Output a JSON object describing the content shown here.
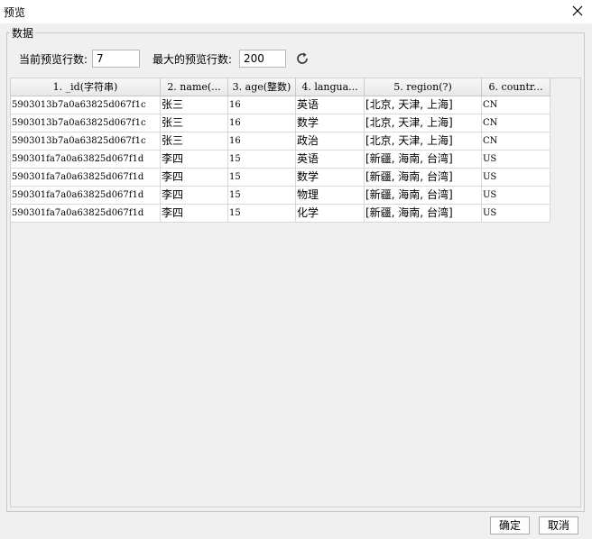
{
  "window": {
    "title": "预览"
  },
  "group": {
    "label": "数据"
  },
  "preview": {
    "current_rows_label": "当前预览行数:",
    "current_rows_value": "7",
    "max_rows_label": "最大的预览行数:",
    "max_rows_value": "200"
  },
  "table": {
    "columns": [
      "1. _id(字符串)",
      "2. name(...",
      "3. age(整数)",
      "4. langua...",
      "5. region(?)",
      "6. countr..."
    ],
    "rows": [
      [
        "5903013b7a0a63825d067f1c",
        "张三",
        "16",
        "英语",
        "[北京, 天津, 上海]",
        "CN"
      ],
      [
        "5903013b7a0a63825d067f1c",
        "张三",
        "16",
        "数学",
        "[北京, 天津, 上海]",
        "CN"
      ],
      [
        "5903013b7a0a63825d067f1c",
        "张三",
        "16",
        "政治",
        "[北京, 天津, 上海]",
        "CN"
      ],
      [
        "590301fa7a0a63825d067f1d",
        "李四",
        "15",
        "英语",
        "[新疆, 海南, 台湾]",
        "US"
      ],
      [
        "590301fa7a0a63825d067f1d",
        "李四",
        "15",
        "数学",
        "[新疆, 海南, 台湾]",
        "US"
      ],
      [
        "590301fa7a0a63825d067f1d",
        "李四",
        "15",
        "物理",
        "[新疆, 海南, 台湾]",
        "US"
      ],
      [
        "590301fa7a0a63825d067f1d",
        "李四",
        "15",
        "化学",
        "[新疆, 海南, 台湾]",
        "US"
      ]
    ]
  },
  "buttons": {
    "ok": "确定",
    "cancel": "取消"
  },
  "icons": {
    "close": "close-icon",
    "refresh": "refresh-icon"
  }
}
